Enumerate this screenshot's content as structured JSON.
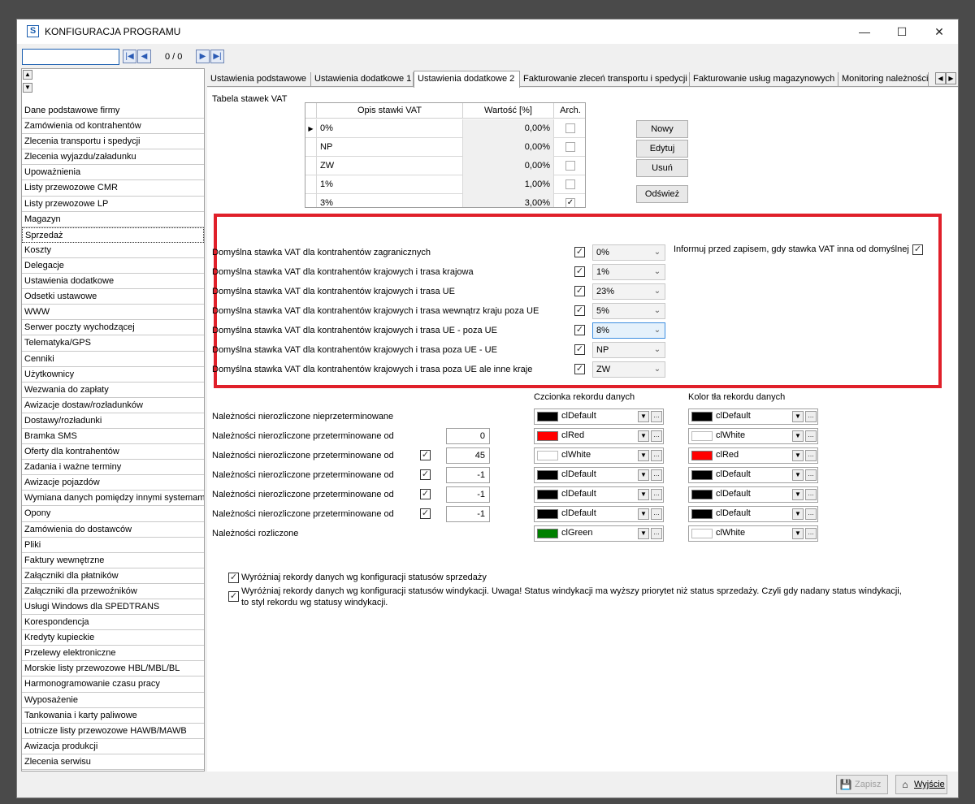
{
  "window": {
    "title": "KONFIGURACJA PROGRAMU",
    "app_icon": "S"
  },
  "controls": {
    "minimize": "—",
    "maximize": "☐",
    "close": "✕"
  },
  "navigator": {
    "counter": "0 / 0",
    "first": "|◀",
    "prev": "◀",
    "next": "▶",
    "last": "▶|"
  },
  "sidebar": {
    "items": [
      "Dane podstawowe firmy",
      "Zamówienia od kontrahentów",
      "Zlecenia transportu i spedycji",
      "Zlecenia wyjazdu/załadunku",
      "Upoważnienia",
      "Listy przewozowe CMR",
      "Listy przewozowe LP",
      "Magazyn",
      "Sprzedaż",
      "Koszty",
      "Delegacje",
      "Ustawienia dodatkowe",
      "Odsetki ustawowe",
      "WWW",
      "Serwer poczty wychodzącej",
      "Telematyka/GPS",
      "Cenniki",
      "Użytkownicy",
      "Wezwania do zapłaty",
      "Awizacje dostaw/rozładunków",
      "Dostawy/rozładunki",
      "Bramka SMS",
      "Oferty dla kontrahentów",
      "Zadania i ważne terminy",
      "Awizacje pojazdów",
      "Wymiana danych pomiędzy innymi systemami",
      "Opony",
      "Zamówienia do dostawców",
      "Pliki",
      "Faktury wewnętrzne",
      "Załączniki dla płatników",
      "Załączniki dla przewoźników",
      "Usługi Windows dla SPEDTRANS",
      "Korespondencja",
      "Kredyty kupieckie",
      "Przelewy elektroniczne",
      "Morskie listy przewozowe HBL/MBL/BL",
      "Harmonogramowanie czasu pracy",
      "Wyposażenie",
      "Tankowania i karty paliwowe",
      "Lotnicze listy przewozowe HAWB/MAWB",
      "Awizacja produkcji",
      "Zlecenia serwisu"
    ],
    "selected": "Sprzedaż"
  },
  "tabs": [
    "Ustawienia podstawowe",
    "Ustawienia dodatkowe 1",
    "Ustawienia dodatkowe 2",
    "Fakturowanie zleceń transportu i spedycji",
    "Fakturowanie usług magazynowych",
    "Monitoring należności"
  ],
  "active_tab": "Ustawienia dodatkowe 2",
  "vat_table": {
    "label": "Tabela stawek VAT",
    "headers": [
      "Opis stawki VAT",
      "Wartość [%]",
      "Arch."
    ],
    "rows": [
      {
        "desc": "0%",
        "value": "0,00%",
        "arch": false,
        "current": true
      },
      {
        "desc": "NP",
        "value": "0,00%",
        "arch": false
      },
      {
        "desc": "ZW",
        "value": "0,00%",
        "arch": false
      },
      {
        "desc": "1%",
        "value": "1,00%",
        "arch": false
      },
      {
        "desc": "3%",
        "value": "3,00%",
        "arch": true
      }
    ],
    "buttons": {
      "new": "Nowy",
      "edit": "Edytuj",
      "delete": "Usuń",
      "refresh": "Odśwież"
    }
  },
  "default_vat": {
    "rows": [
      {
        "label": "Domyślna stawka VAT dla kontrahentów zagranicznych",
        "checked": true,
        "value": "0%"
      },
      {
        "label": "Domyślna stawka VAT dla kontrahentów krajowych i trasa krajowa",
        "checked": true,
        "value": "1%"
      },
      {
        "label": "Domyślna stawka VAT dla kontrahentów krajowych i trasa UE",
        "checked": true,
        "value": "23%"
      },
      {
        "label": "Domyślna stawka VAT dla kontrahentów krajowych i trasa wewnątrz kraju  poza UE",
        "checked": true,
        "value": "5%"
      },
      {
        "label": "Domyślna stawka VAT dla kontrahentów krajowych i trasa UE - poza UE",
        "checked": true,
        "value": "8%"
      },
      {
        "label": "Domyślna stawka VAT dla kontrahentów krajowych i trasa poza UE - UE",
        "checked": true,
        "value": "NP"
      },
      {
        "label": "Domyślna stawka VAT dla kontrahentów krajowych i trasa  poza UE ale inne kraje",
        "checked": true,
        "value": "ZW"
      }
    ],
    "inform_label": "Informuj przed zapisem, gdy stawka VAT inna od domyślnej",
    "inform_checked": true
  },
  "receivables": {
    "font_header": "Czcionka rekordu danych",
    "bg_header": "Kolor tła rekordu danych",
    "rows": [
      {
        "label": "Należności nierozliczone nieprzeterminowane",
        "has_check": false,
        "days": null,
        "font": {
          "name": "clDefault",
          "color": "#000000"
        },
        "bg": {
          "name": "clDefault",
          "color": "#000000"
        }
      },
      {
        "label": "Należności nierozliczone przeterminowane od",
        "has_check": false,
        "days": "0",
        "font": {
          "name": "clRed",
          "color": "#ff0000"
        },
        "bg": {
          "name": "clWhite",
          "color": "#ffffff"
        }
      },
      {
        "label": "Należności nierozliczone przeterminowane od",
        "has_check": true,
        "days": "45",
        "font": {
          "name": "clWhite",
          "color": "#ffffff"
        },
        "bg": {
          "name": "clRed",
          "color": "#ff0000"
        }
      },
      {
        "label": "Należności nierozliczone przeterminowane od",
        "has_check": true,
        "days": "-1",
        "font": {
          "name": "clDefault",
          "color": "#000000"
        },
        "bg": {
          "name": "clDefault",
          "color": "#000000"
        }
      },
      {
        "label": "Należności nierozliczone przeterminowane od",
        "has_check": true,
        "days": "-1",
        "font": {
          "name": "clDefault",
          "color": "#000000"
        },
        "bg": {
          "name": "clDefault",
          "color": "#000000"
        }
      },
      {
        "label": "Należności nierozliczone przeterminowane od",
        "has_check": true,
        "days": "-1",
        "font": {
          "name": "clDefault",
          "color": "#000000"
        },
        "bg": {
          "name": "clDefault",
          "color": "#000000"
        }
      },
      {
        "label": "Należności rozliczone",
        "has_check": false,
        "days": null,
        "font": {
          "name": "clGreen",
          "color": "#008000"
        },
        "bg": {
          "name": "clWhite",
          "color": "#ffffff"
        }
      }
    ]
  },
  "options": {
    "sales_status": "Wyróżniaj rekordy danych wg konfiguracji statusów sprzedaży",
    "vindication_status_line1": "Wyróżniaj rekordy danych wg konfiguracji statusów windykacji. Uwaga! Status windykacji ma wyższy priorytet niż status sprzedaży.  Czyli gdy nadany status windykacji,",
    "vindication_status_line2": "to styl rekordu wg statusy windykacji."
  },
  "footer": {
    "save": "Zapisz",
    "exit": "Wyjście"
  },
  "colors": {
    "highlight_border": "#e0202a",
    "accent": "#1c5fb0"
  }
}
